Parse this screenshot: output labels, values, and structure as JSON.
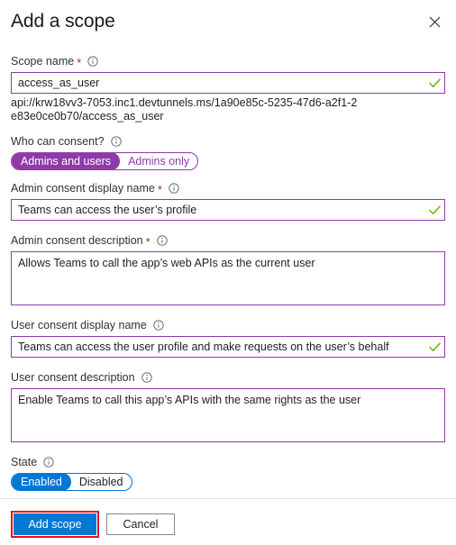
{
  "dialog": {
    "title": "Add a scope",
    "close_icon": "close-icon"
  },
  "fields": {
    "scope_name": {
      "label": "Scope name",
      "required_marker": "*",
      "info_icon": "info-icon",
      "value": "access_as_user",
      "placeholder": "",
      "valid_icon": "checkmark-icon",
      "hint": "api://krw18vv3-7053.inc1.devtunnels.ms/1a90e85c-5235-47d6-a2f1-2e83e0ce0b70/access_as_user"
    },
    "who_can_consent": {
      "label": "Who can consent?",
      "info_icon": "info-icon",
      "options": [
        "Admins and users",
        "Admins only"
      ],
      "selected": "Admins and users",
      "accent_color": "#8f3aa8"
    },
    "admin_consent_display_name": {
      "label": "Admin consent display name",
      "required_marker": "*",
      "info_icon": "info-icon",
      "value": "Teams can access the user’s profile",
      "placeholder": "",
      "valid_icon": "checkmark-icon"
    },
    "admin_consent_description": {
      "label": "Admin consent description",
      "required_marker": "*",
      "info_icon": "info-icon",
      "value": "Allows Teams to call the app’s web APIs as the current user",
      "placeholder": ""
    },
    "user_consent_display_name": {
      "label": "User consent display name",
      "required_marker": "",
      "info_icon": "info-icon",
      "value": "Teams can access the user profile and make requests on the user’s behalf",
      "placeholder": "",
      "valid_icon": "checkmark-icon"
    },
    "user_consent_description": {
      "label": "User consent description",
      "required_marker": "",
      "info_icon": "info-icon",
      "value": "Enable Teams to call this app’s APIs with the same rights as the user",
      "placeholder": ""
    },
    "state": {
      "label": "State",
      "info_icon": "info-icon",
      "options": [
        "Enabled",
        "Disabled"
      ],
      "selected": "Enabled",
      "accent_color": "#0078d4"
    }
  },
  "footer": {
    "primary_label": "Add scope",
    "secondary_label": "Cancel",
    "highlight_color": "#e81123"
  },
  "colors": {
    "field_border": "#8f3aa8",
    "valid_check": "#6bb700",
    "required_star": "#a4262c",
    "primary": "#0078d4"
  }
}
